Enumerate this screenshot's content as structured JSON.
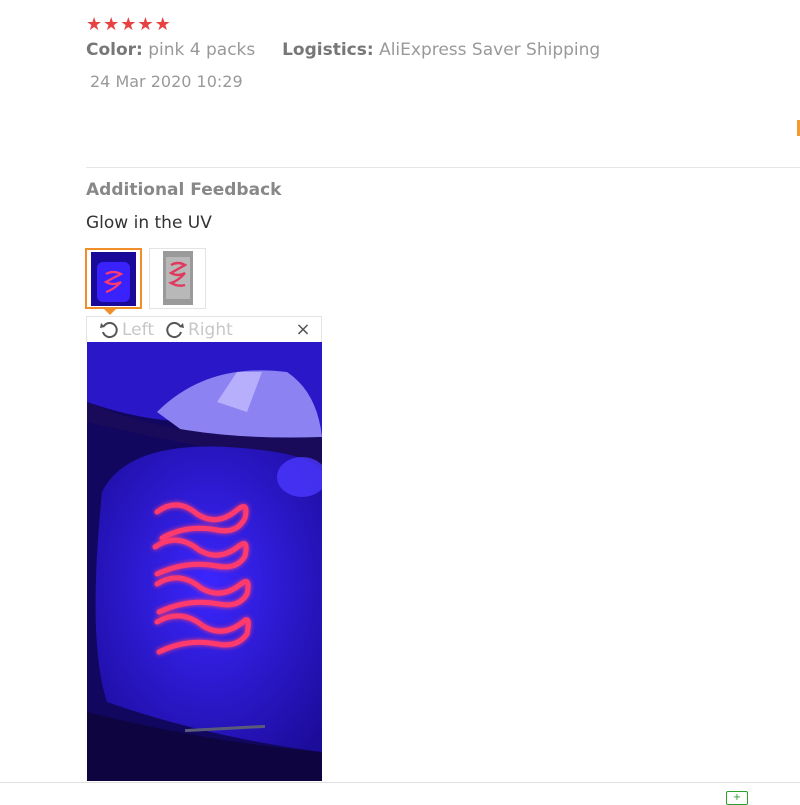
{
  "review": {
    "rating": 5,
    "color_label": "Color:",
    "color_value": "pink 4 packs",
    "logistics_label": "Logistics:",
    "logistics_value": "AliExpress Saver Shipping",
    "date": "24 Mar 2020 10:29"
  },
  "additional_feedback": {
    "title": "Additional Feedback",
    "text": "Glow in the UV"
  },
  "viewer": {
    "rotate_left_label": "Left",
    "rotate_right_label": "Right",
    "close_label": "×",
    "thumbnails": 2,
    "selected_thumbnail": 1
  },
  "colors": {
    "star": "#e84142",
    "accent": "#f08f2a",
    "uv_purple": "#2a14e0",
    "glow_pink": "#ff3a6e"
  },
  "icons": [
    "star-icon",
    "rotate-left-icon",
    "rotate-right-icon",
    "close-icon"
  ]
}
